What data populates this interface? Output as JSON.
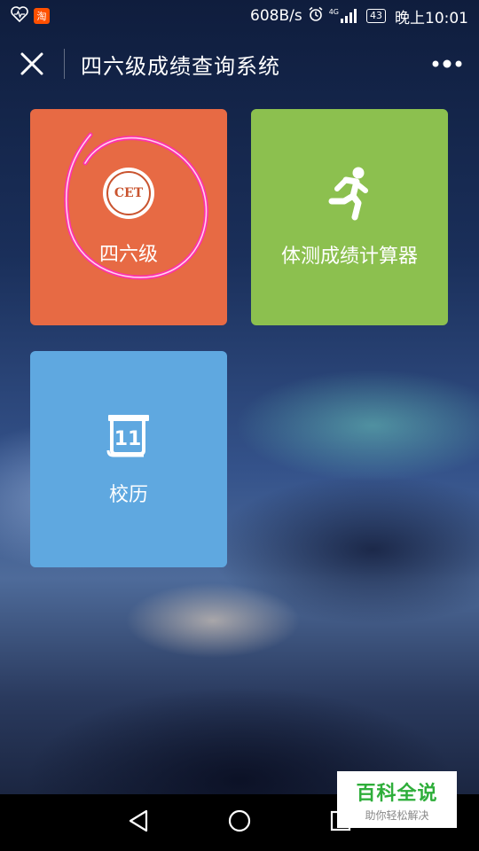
{
  "status_bar": {
    "taobao_label": "淘",
    "speed": "608B/s",
    "signal": "4G",
    "battery": "43",
    "time": "晚上10:01"
  },
  "navbar": {
    "title": "四六级成绩查询系统"
  },
  "tiles": [
    {
      "label": "四六级",
      "badge_text": "CET",
      "color": "#e76a44"
    },
    {
      "label": "体测成绩计算器",
      "color": "#8cc04f"
    },
    {
      "label": "校历",
      "calendar_number": "11",
      "color": "#5fa8e0"
    }
  ],
  "annotation_color": "#ff2fb0",
  "watermark": {
    "title": "百科全说",
    "subtitle": "助你轻松解决"
  }
}
